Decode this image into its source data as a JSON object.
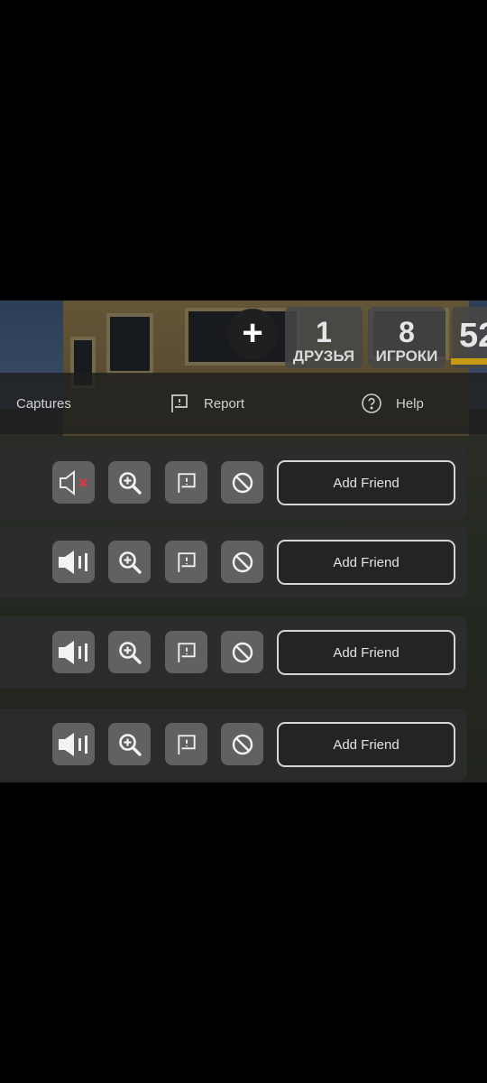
{
  "hud": {
    "plus_label": "+",
    "stats": [
      {
        "num": "1",
        "label": "ДРУЗЬЯ"
      },
      {
        "num": "8",
        "label": "ИГРОКИ"
      },
      {
        "num": "52",
        "label": ""
      }
    ]
  },
  "menu": {
    "captures_label": "Captures",
    "report_label": "Report",
    "help_label": "Help"
  },
  "players": [
    {
      "muted": true,
      "add_friend_label": "Add Friend"
    },
    {
      "muted": false,
      "add_friend_label": "Add Friend"
    },
    {
      "muted": false,
      "add_friend_label": "Add Friend"
    },
    {
      "muted": false,
      "add_friend_label": "Add Friend"
    }
  ],
  "icons": {
    "mute": "speaker-muted-icon",
    "speaker": "speaker-icon",
    "inspect": "zoom-in-icon",
    "report": "flag-icon",
    "block": "block-icon"
  },
  "colors": {
    "accent_gold": "#c69b13",
    "mute_x": "#e0353f"
  }
}
